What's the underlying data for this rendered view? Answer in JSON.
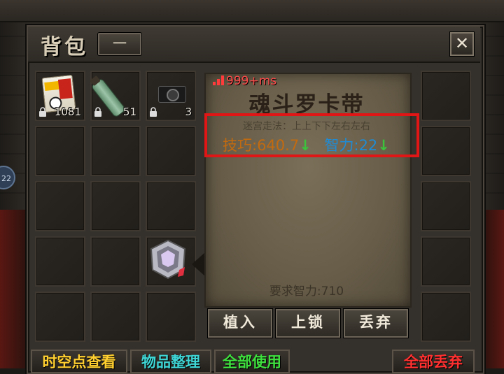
{
  "window": {
    "title": "背包",
    "minimize_label": "一",
    "close_label": "✕"
  },
  "side_badge": "22",
  "inventory": {
    "items": [
      {
        "name": "food-bag-item",
        "qty": "1081",
        "locked": true
      },
      {
        "name": "bottle-item",
        "qty": "51",
        "locked": true
      },
      {
        "name": "camera-item",
        "qty": "3",
        "locked": true
      }
    ]
  },
  "detail": {
    "ping": "999+ms",
    "title": "魂斗罗卡带",
    "description": "迷宫走法：上上下下左右左右",
    "stat1_label": "技巧:640.7",
    "stat1_arrow": "↓",
    "stat2_label": "智力:22",
    "stat2_arrow": "↓",
    "requirement": "要求智力:710",
    "buttons": {
      "implant": "植入",
      "lock": "上锁",
      "discard": "丢弃"
    }
  },
  "bottom_bar": {
    "time_point": "时空点查看",
    "sort": "物品整理",
    "use_all": "全部使用",
    "discard_all": "全部丢弃"
  },
  "colors": {
    "stat_skill": "#c26a10",
    "stat_int": "#1f8bd4",
    "down_arrow": "#3cc23c",
    "ping": "#ff4a4a",
    "highlight": "#e01515",
    "btn_time_point": "#ffcf30",
    "btn_sort": "#3fd6d6",
    "btn_use_all": "#3ee03e",
    "btn_discard_all": "#ff3030"
  }
}
